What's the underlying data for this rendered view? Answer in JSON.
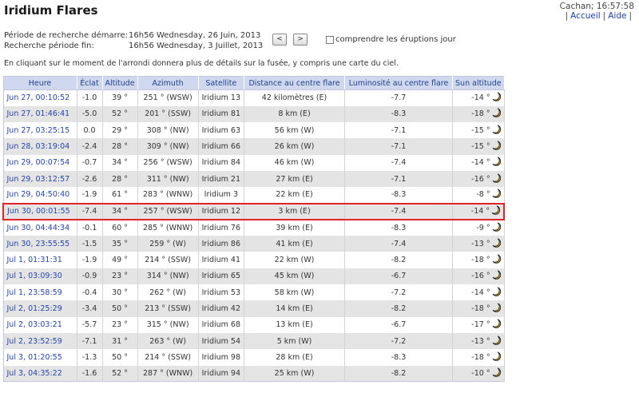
{
  "page": {
    "title": "Iridium Flares"
  },
  "topright": {
    "location_time": "Cachan; 16:57:58",
    "link_home": "Accueil",
    "link_help": "Aide"
  },
  "period": {
    "start_label": "Période de recherche démarre:",
    "start_value": "16h56 Wednesday, 26 Juin, 2013",
    "end_label": "Recherche période fin:",
    "end_value": "16h56 Wednesday, 3 Juillet, 2013"
  },
  "nav": {
    "prev": "<",
    "next": ">"
  },
  "checkbox": {
    "label": "comprendre les éruptions jour"
  },
  "info_text": "En cliquant sur le moment de l'arrondi donnera plus de détails sur la fusée, y compris une carte du ciel.",
  "table": {
    "headers": [
      "Heure",
      "Éclat",
      "Altitude",
      "Azimuth",
      "Satellite",
      "Distance au centre flare",
      "Luminosité au centre flare",
      "Sun altitude"
    ],
    "highlight_row": 7,
    "rows": [
      [
        "Jun 27, 00:10:52",
        "-1.0",
        "39 °",
        "251 ° (WSW)",
        "Iridium 13",
        "42 kilomètres (E)",
        "-7.7",
        "-14 °"
      ],
      [
        "Jun 27, 01:46:41",
        "-5.0",
        "52 °",
        "201 ° (SSW)",
        "Iridium 81",
        "8 km (E)",
        "-8.3",
        "-18 °"
      ],
      [
        "Jun 27, 03:25:15",
        "0.0",
        "29 °",
        "308 ° (NW)",
        "Iridium 63",
        "56 km (W)",
        "-7.1",
        "-15 °"
      ],
      [
        "Jun 28, 03:19:04",
        "-2.4",
        "28 °",
        "309 ° (NW)",
        "Iridium 66",
        "26 km (W)",
        "-7.1",
        "-15 °"
      ],
      [
        "Jun 29, 00:07:54",
        "-0.7",
        "34 °",
        "256 ° (WSW)",
        "Iridium 84",
        "46 km (W)",
        "-7.4",
        "-14 °"
      ],
      [
        "Jun 29, 03:12:57",
        "-2.6",
        "28 °",
        "311 ° (NW)",
        "Iridium 21",
        "27 km (E)",
        "-7.1",
        "-16 °"
      ],
      [
        "Jun 29, 04:50:40",
        "-1.9",
        "61 °",
        "283 ° (WNW)",
        "Iridium 3",
        "22 km (E)",
        "-8.3",
        "-8 °"
      ],
      [
        "Jun 30, 00:01:55",
        "-7.4",
        "34 °",
        "257 ° (WSW)",
        "Iridium 12",
        "3 km (E)",
        "-7.4",
        "-14 °"
      ],
      [
        "Jun 30, 04:44:34",
        "-0.1",
        "60 °",
        "285 ° (WNW)",
        "Iridium 76",
        "39 km (E)",
        "-8.3",
        "-9 °"
      ],
      [
        "Jun 30, 23:55:55",
        "-1.5",
        "35 °",
        "259 ° (W)",
        "Iridium 86",
        "41 km (E)",
        "-7.4",
        "-13 °"
      ],
      [
        "Jul 1, 01:31:31",
        "-1.9",
        "49 °",
        "214 ° (SSW)",
        "Iridium 41",
        "22 km (W)",
        "-8.2",
        "-18 °"
      ],
      [
        "Jul 1, 03:09:30",
        "-0.9",
        "23 °",
        "314 ° (NW)",
        "Iridium 65",
        "45 km (W)",
        "-6.7",
        "-16 °"
      ],
      [
        "Jul 1, 23:58:59",
        "-0.4",
        "30 °",
        "262 ° (W)",
        "Iridium 53",
        "58 km (W)",
        "-7.2",
        "-14 °"
      ],
      [
        "Jul 2, 01:25:29",
        "-3.4",
        "50 °",
        "213 ° (SSW)",
        "Iridium 42",
        "14 km (E)",
        "-8.2",
        "-18 °"
      ],
      [
        "Jul 2, 03:03:21",
        "-5.7",
        "23 °",
        "315 ° (NW)",
        "Iridium 68",
        "13 km (E)",
        "-6.7",
        "-17 °"
      ],
      [
        "Jul 2, 23:52:59",
        "-7.1",
        "31 °",
        "263 ° (W)",
        "Iridium 54",
        "5 km (W)",
        "-7.2",
        "-13 °"
      ],
      [
        "Jul 3, 01:20:55",
        "-1.3",
        "50 °",
        "214 ° (SSW)",
        "Iridium 98",
        "28 km (E)",
        "-8.3",
        "-18 °"
      ],
      [
        "Jul 3, 04:35:22",
        "-1.6",
        "52 °",
        "287 ° (WNW)",
        "Iridium 94",
        "25 km (W)",
        "-8.2",
        "-10 °"
      ]
    ],
    "sun_icon": "crescent-moon-icon",
    "colors": {
      "header_bg": "#cfd8ef",
      "header_text": "#23418c",
      "alt_row": "#e4e4e4",
      "link": "#2544a8",
      "highlight_border": "#e0242a",
      "moon": "#f2b800"
    }
  }
}
